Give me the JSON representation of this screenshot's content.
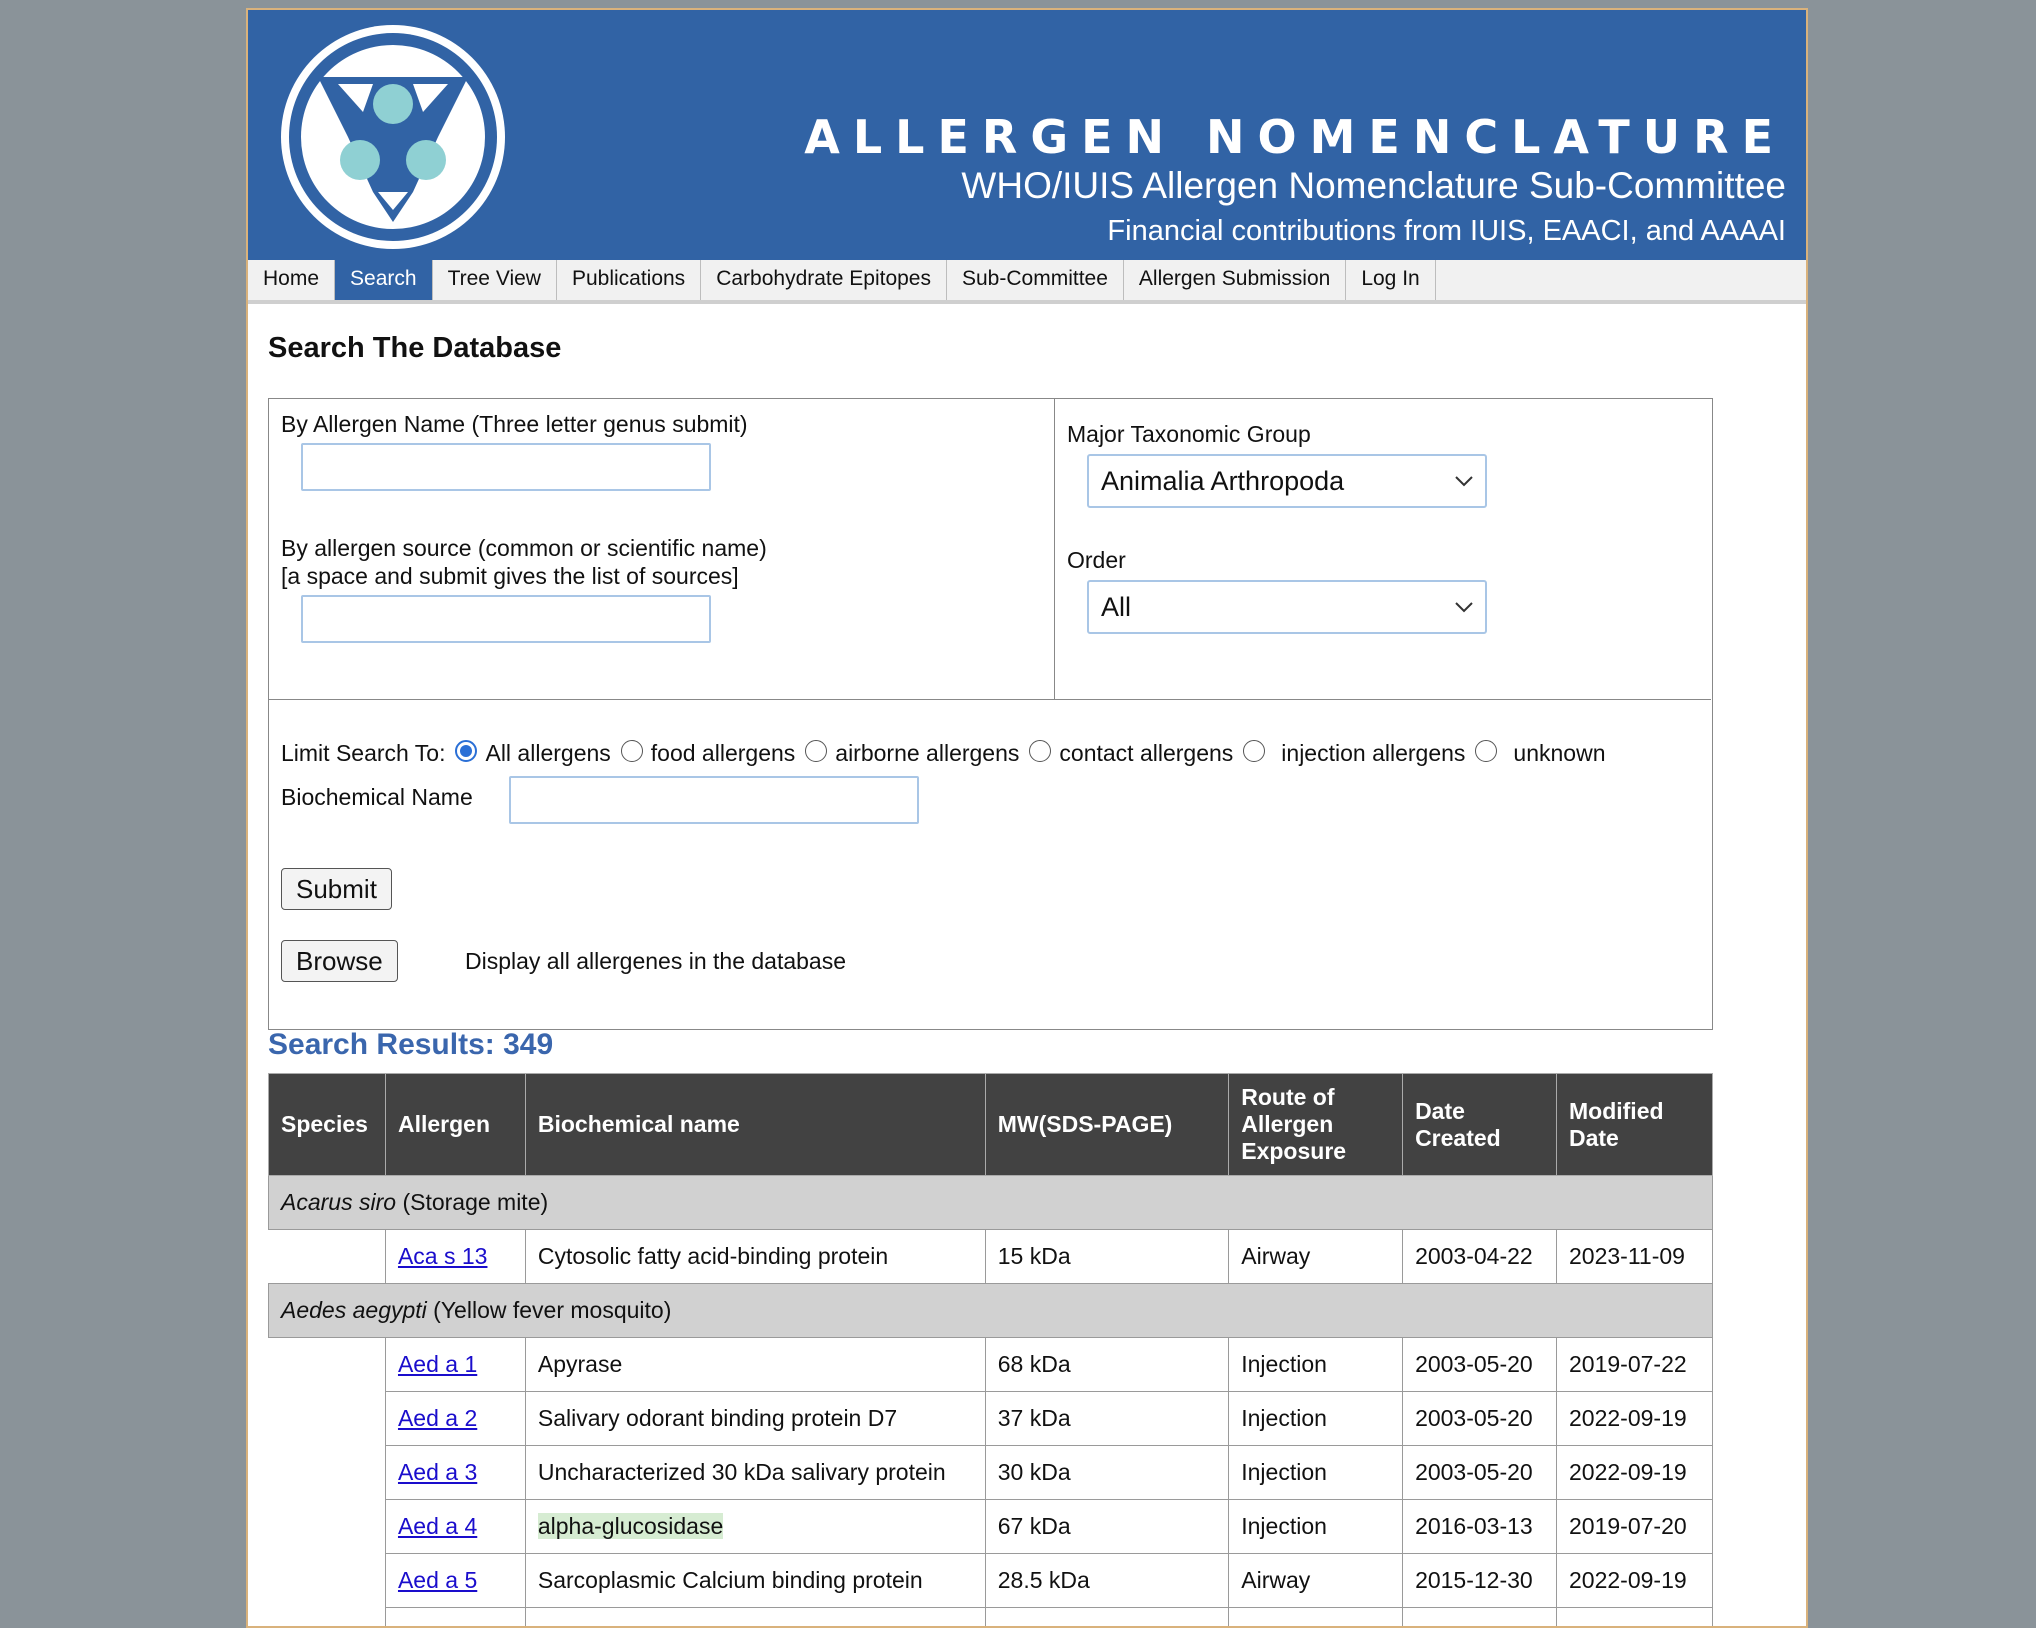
{
  "header": {
    "title": "ALLERGEN NOMENCLATURE",
    "subtitle": "WHO/IUIS Allergen Nomenclature Sub-Committee",
    "funding": "Financial contributions from IUIS, EAACI, and AAAAI",
    "logo_icon": "iuis-logo-icon",
    "brand_color": "#3163a5"
  },
  "nav": {
    "items": [
      {
        "label": "Home"
      },
      {
        "label": "Search"
      },
      {
        "label": "Tree View"
      },
      {
        "label": "Publications"
      },
      {
        "label": "Carbohydrate Epitopes"
      },
      {
        "label": "Sub-Committee"
      },
      {
        "label": "Allergen Submission"
      },
      {
        "label": "Log In"
      }
    ],
    "active": "Search"
  },
  "search": {
    "heading": "Search The Database",
    "allergen_name_label": "By Allergen Name (Three letter genus submit)",
    "allergen_name_value": "",
    "source_label_line1": "By allergen source (common or scientific name)",
    "source_label_line2": "[a space and submit gives the list of sources]",
    "source_value": "",
    "taxonomic_label": "Major Taxonomic Group",
    "taxonomic_selected": "Animalia Arthropoda",
    "order_label": "Order",
    "order_selected": "All",
    "limit_label": "Limit Search To:",
    "limit_options": [
      {
        "label": "All allergens",
        "checked": true
      },
      {
        "label": "food allergens",
        "checked": false
      },
      {
        "label": "airborne allergens",
        "checked": false
      },
      {
        "label": "contact allergens",
        "checked": false
      },
      {
        "label": "injection allergens",
        "checked": false
      },
      {
        "label": "unknown",
        "checked": false
      }
    ],
    "biochemical_label": "Biochemical Name",
    "biochemical_value": "",
    "submit_label": "Submit",
    "browse_label": "Browse",
    "browse_desc": "Display all allergenes in the database"
  },
  "results": {
    "heading": "Search Results: 349",
    "accent_color": "#3a66ad",
    "columns": [
      "Species",
      "Allergen",
      "Biochemical name",
      "MW(SDS-PAGE)",
      "Route of Allergen Exposure",
      "Date Created",
      "Modified Date"
    ],
    "groups": [
      {
        "species_latin": "Acarus siro",
        "species_common": "(Storage mite)",
        "rows": [
          {
            "allergen": "Aca s 13",
            "name": "Cytosolic fatty acid-binding protein",
            "mw": "15 kDa",
            "route": "Airway",
            "created": "2003-04-22",
            "modified": "2023-11-09"
          }
        ]
      },
      {
        "species_latin": "Aedes aegypti",
        "species_common": "(Yellow fever mosquito)",
        "rows": [
          {
            "allergen": "Aed a 1",
            "name": "Apyrase",
            "mw": "68 kDa",
            "route": "Injection",
            "created": "2003-05-20",
            "modified": "2019-07-22"
          },
          {
            "allergen": "Aed a 2",
            "name": "Salivary odorant binding protein D7",
            "mw": "37 kDa",
            "route": "Injection",
            "created": "2003-05-20",
            "modified": "2022-09-19"
          },
          {
            "allergen": "Aed a 3",
            "name": "Uncharacterized 30 kDa salivary protein",
            "mw": "30 kDa",
            "route": "Injection",
            "created": "2003-05-20",
            "modified": "2022-09-19"
          },
          {
            "allergen": "Aed a 4",
            "name": "alpha-glucosidase",
            "mw": "67 kDa",
            "route": "Injection",
            "created": "2016-03-13",
            "modified": "2019-07-20"
          },
          {
            "allergen": "Aed a 5",
            "name": "Sarcoplasmic Calcium binding protein",
            "mw": "28.5 kDa",
            "route": "Airway",
            "created": "2015-12-30",
            "modified": "2022-09-19"
          }
        ]
      }
    ]
  }
}
